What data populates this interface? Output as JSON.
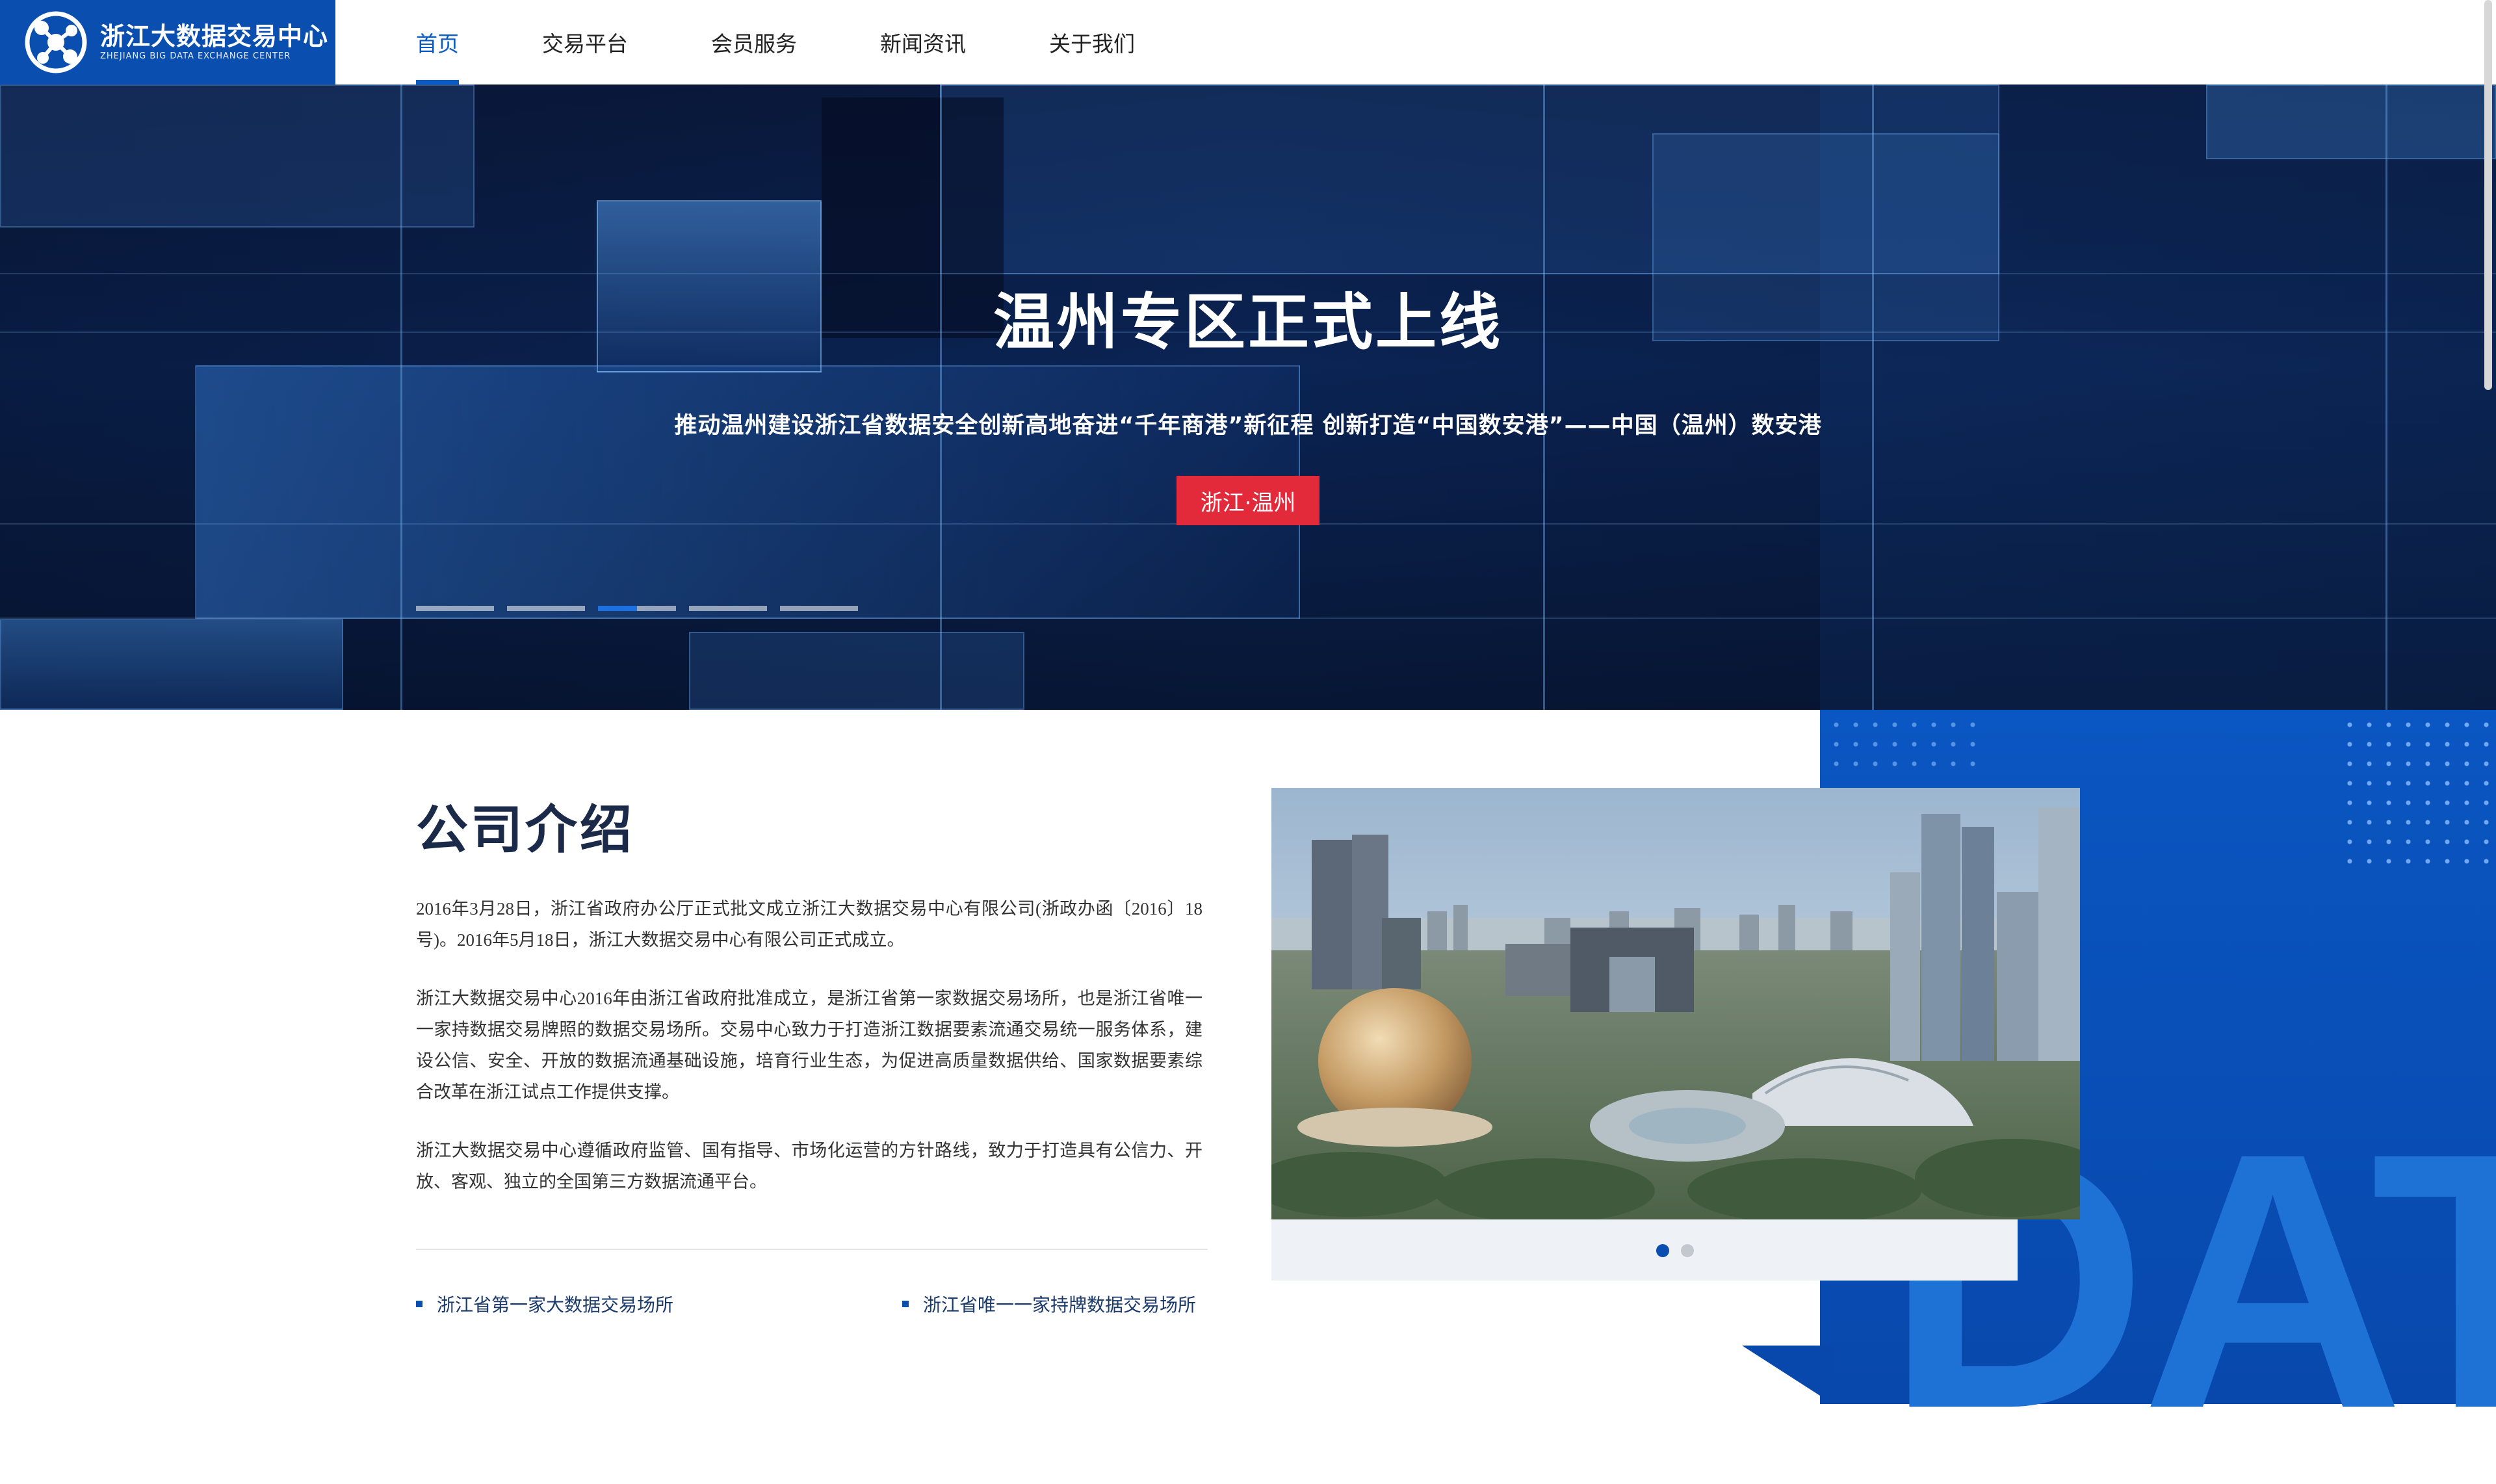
{
  "logo": {
    "cn": "浙江大数据交易中心",
    "en": "ZHEJIANG BIG DATA EXCHANGE CENTER",
    "icon": "molecule-logo-icon",
    "color": "#0a4fb0"
  },
  "nav": {
    "items": [
      {
        "label": "首页",
        "active": true
      },
      {
        "label": "交易平台",
        "active": false
      },
      {
        "label": "会员服务",
        "active": false
      },
      {
        "label": "新闻资讯",
        "active": false
      },
      {
        "label": "关于我们",
        "active": false
      }
    ],
    "accent": "#0a5bc4"
  },
  "hero": {
    "title": "温州专区正式上线",
    "subtitle": "推动温州建设浙江省数据安全创新高地奋进“千年商港”新征程 创新打造“中国数安港”——中国（温州）数安港",
    "button_label": "浙江·温州",
    "button_color": "#e22a3a",
    "slide_count": 5,
    "active_slide": 3
  },
  "intro": {
    "title": "公司介绍",
    "paragraphs": [
      "2016年3月28日，浙江省政府办公厅正式批文成立浙江大数据交易中心有限公司(浙政办函〔2016〕18号)。2016年5月18日，浙江大数据交易中心有限公司正式成立。",
      "浙江大数据交易中心2016年由浙江省政府批准成立，是浙江省第一家数据交易场所，也是浙江省唯一一家持数据交易牌照的数据交易场所。交易中心致力于打造浙江数据要素流通交易统一服务体系，建设公信、安全、开放的数据流通基础设施，培育行业生态，为促进高质量数据供给、国家数据要素综合改革在浙江试点工作提供支撑。",
      "浙江大数据交易中心遵循政府监管、国有指导、市场化运营的方针路线，致力于打造具有公信力、开放、客观、独立的全国第三方数据流通平台。"
    ],
    "features": [
      "浙江省第一家大数据交易场所",
      "浙江省唯一一家持牌数据交易场所"
    ],
    "photo_slide_count": 2,
    "photo_active_slide": 1,
    "deco_text": "DAT"
  }
}
